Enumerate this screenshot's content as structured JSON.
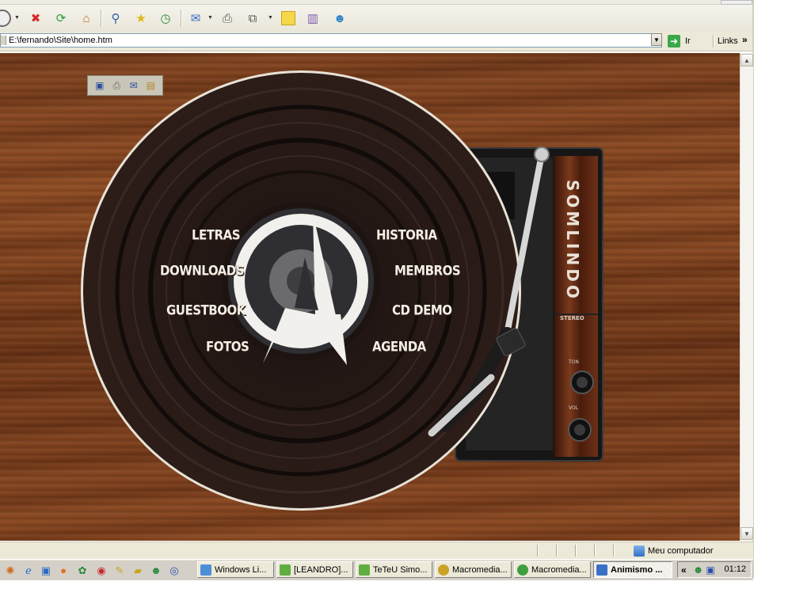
{
  "browser": {
    "address": "E:\\fernando\\Site\\home.htm",
    "go_label": "Ir",
    "links_label": "Links",
    "links_chevron": "»",
    "toolbar_icons": [
      "back-icon",
      "stop-icon",
      "refresh-icon",
      "home-icon",
      "search-icon",
      "favorites-icon",
      "history-icon",
      "mail-icon",
      "print-icon",
      "fullscreen-icon",
      "notes-icon",
      "research-icon",
      "messenger-icon"
    ]
  },
  "page": {
    "content_toolbar_icons": [
      "save-icon",
      "print-icon",
      "mail-icon",
      "printer-icon"
    ],
    "menu_left": [
      "LETRAS",
      "DOWNLOADS",
      "GUESTBOOK",
      "FOTOS"
    ],
    "menu_right": [
      "HISTORIA",
      "MEMBROS",
      "CD DEMO",
      "AGENDA"
    ],
    "turntable_brand": "SOMLINDO",
    "turntable_stereo": "STEREO",
    "turntable_ton": "TON",
    "turntable_vol": "VOL"
  },
  "statusbar": {
    "zone_label": "Meu computador"
  },
  "taskbar": {
    "tasks": [
      {
        "label": "Windows Li...",
        "color": "#4d8fd6"
      },
      {
        "label": "[LEANDRO]...",
        "color": "#5fae3f"
      },
      {
        "label": "TeTeU Simo...",
        "color": "#5fae3f"
      },
      {
        "label": "Macromedia...",
        "color": "#c9a227"
      },
      {
        "label": "Macromedia...",
        "color": "#3f9e3f"
      },
      {
        "label": "Animismo ...",
        "color": "#3a6fc7"
      }
    ],
    "tray_chevron": "«",
    "clock": "01:12"
  }
}
